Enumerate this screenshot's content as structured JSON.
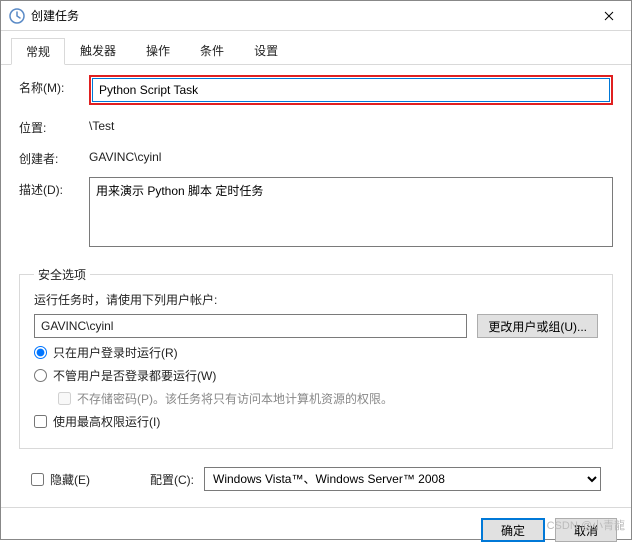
{
  "window": {
    "title": "创建任务"
  },
  "tabs": [
    "常规",
    "触发器",
    "操作",
    "条件",
    "设置"
  ],
  "form": {
    "name_label": "名称(M):",
    "name_value": "Python Script Task",
    "location_label": "位置:",
    "location_value": "\\Test",
    "author_label": "创建者:",
    "author_value": "GAVINC\\cyinl",
    "description_label": "描述(D):",
    "description_value": "用来演示 Python 脚本 定时任务"
  },
  "security": {
    "legend": "安全选项",
    "run_as_label": "运行任务时，请使用下列用户帐户:",
    "account": "GAVINC\\cyinl",
    "change_user_btn": "更改用户或组(U)...",
    "radio_logged_on": "只在用户登录时运行(R)",
    "radio_any": "不管用户是否登录都要运行(W)",
    "no_password": "不存储密码(P)。该任务将只有访问本地计算机资源的权限。",
    "highest_priv": "使用最高权限运行(I)"
  },
  "bottom": {
    "hidden": "隐藏(E)",
    "config_label": "配置(C):",
    "config_value": "Windows Vista™、Windows Server™ 2008"
  },
  "buttons": {
    "ok": "确定",
    "cancel": "取消"
  },
  "watermark": "CSDN @小青龍"
}
